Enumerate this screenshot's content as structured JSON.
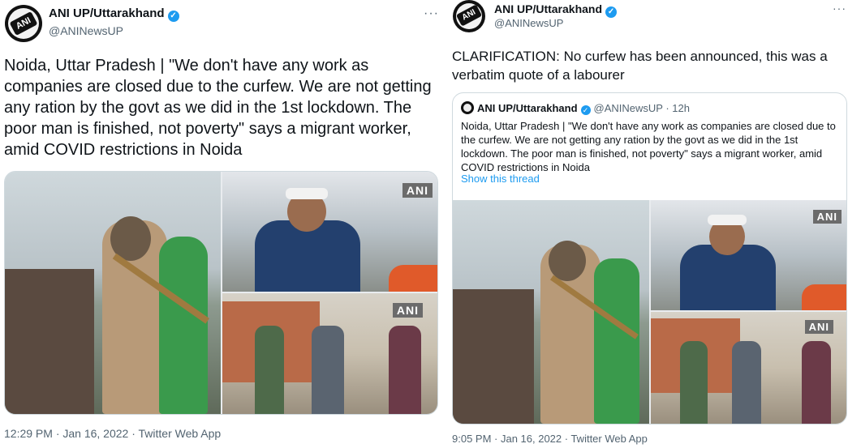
{
  "left": {
    "author": {
      "name": "ANI UP/Uttarakhand",
      "handle": "@ANINewsUP",
      "avatar_text": "ANI"
    },
    "more": "···",
    "text": "Noida, Uttar Pradesh | \"We don't have any work as companies are closed due to the curfew. We are not getting any ration by the govt as we did in the 1st lockdown. The poor man is finished, not poverty\" says a migrant worker, amid COVID restrictions in Noida",
    "media_tags": [
      "ANI",
      "ANI"
    ],
    "footer": "12:29 PM · Jan 16, 2022 · Twitter Web App"
  },
  "right": {
    "author": {
      "name": "ANI UP/Uttarakhand",
      "handle": "@ANINewsUP",
      "avatar_text": "ANI"
    },
    "more": "···",
    "text": "CLARIFICATION: No curfew has been announced, this was a verbatim quote of a labourer",
    "quote": {
      "name": "ANI UP/Uttarakhand",
      "handle_time": "@ANINewsUP · 12h",
      "text": "Noida, Uttar Pradesh | \"We don't have any work as companies are closed due to the curfew. We are not getting any ration by the govt as we did in the 1st lockdown. The poor man is finished, not poverty\" says a migrant worker, amid COVID restrictions in Noida",
      "link": "Show this thread",
      "media_tags": [
        "ANI",
        "ANI"
      ]
    },
    "footer": "9:05 PM · Jan 16, 2022 · Twitter Web App"
  },
  "colors": {
    "verified": "#1d9bf0",
    "link": "#1d9bf0",
    "secondary": "#536471",
    "border": "#cfd9de"
  }
}
